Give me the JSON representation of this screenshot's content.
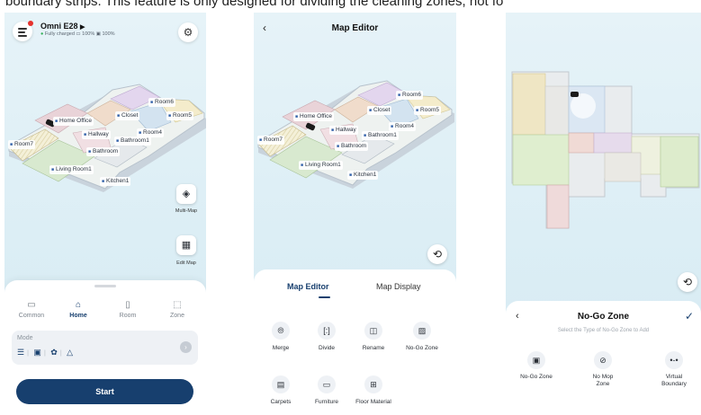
{
  "caption": "boundary strips. This feature is only designed for dividing the cleaning zones, not fo",
  "screen1": {
    "device_name": "Omni E28",
    "device_arrow": "▶",
    "status_dot": "●",
    "status_text": "Fully charged",
    "battery": "▭ 100%",
    "water": "▣ 100%",
    "rooms": [
      "Home Office",
      "Closet",
      "Room6",
      "Room5",
      "Hallway",
      "Room4",
      "Bathroom1",
      "Room7",
      "Bathroom",
      "Living Room1",
      "Kitchen1"
    ],
    "multi_map_label": "Multi-Map",
    "edit_map_label": "Edit Map",
    "tabs": [
      {
        "label": "Common",
        "icon": "▭"
      },
      {
        "label": "Home",
        "icon": "⌂"
      },
      {
        "label": "Room",
        "icon": "▯"
      },
      {
        "label": "Zone",
        "icon": "⬚"
      }
    ],
    "mode_label": "Mode",
    "mode_arrow": "›",
    "start_label": "Start"
  },
  "screen2": {
    "back_icon": "‹",
    "title": "Map Editor",
    "rooms": [
      "Room6",
      "Home Office",
      "Closet",
      "Room5",
      "Hallway",
      "Room4",
      "Bathroom1",
      "Room7",
      "Bathroom",
      "Living Room1",
      "Kitchen1"
    ],
    "tabs": [
      "Map Editor",
      "Map Display"
    ],
    "tools": [
      {
        "label": "Merge",
        "icon": "⦾"
      },
      {
        "label": "Divide",
        "icon": "[:]"
      },
      {
        "label": "Rename",
        "icon": "◫"
      },
      {
        "label": "No-Go Zone",
        "icon": "▨"
      },
      {
        "label": "Carpets",
        "icon": "▤"
      },
      {
        "label": "Furniture",
        "icon": "▭"
      },
      {
        "label": "Floor Material",
        "icon": "⊞"
      }
    ]
  },
  "screen3": {
    "back_icon": "‹",
    "title": "No-Go Zone",
    "confirm_icon": "✓",
    "subtitle": "Select the Type of No-Go Zone to Add",
    "options": [
      {
        "label": "No-Go Zone",
        "icon": "▣"
      },
      {
        "label": "No Mop Zone",
        "icon": "⊘"
      },
      {
        "label": "Virtual Boundary",
        "icon": "•-•"
      }
    ]
  },
  "colors": {
    "accent": "#173f6e",
    "background": "#dceef5",
    "status_green": "#2fae55",
    "alert_red": "#e5322d"
  }
}
